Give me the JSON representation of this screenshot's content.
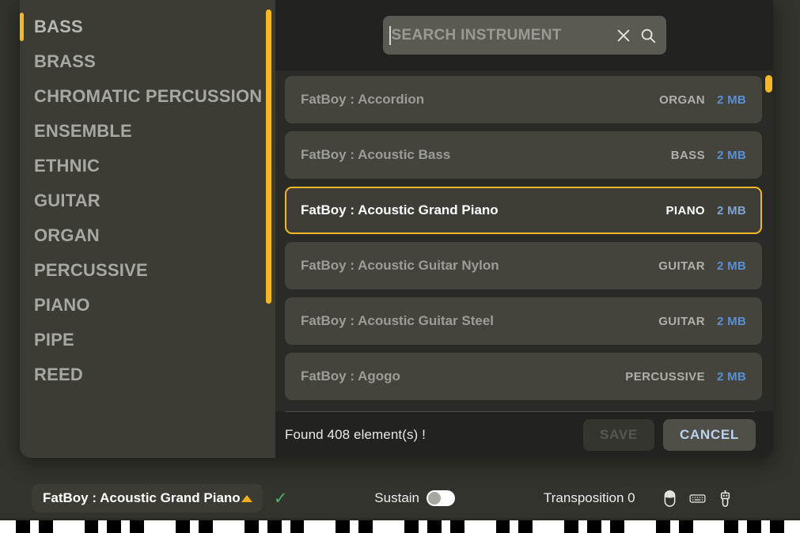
{
  "colors": {
    "accent_yellow": "#f5b824",
    "chip_caret_orange": "#f0ad1e",
    "size_blue": "#5b8fd4",
    "cancel_blue": "#bad2ef",
    "check_green": "#4caf6d",
    "app_background": "#33332d",
    "modal_background": "#222220",
    "sidebar_background": "#3c3c35",
    "row_background": "#44443c"
  },
  "sidebar": {
    "name": "instrument-category-list",
    "selected": "BASS",
    "items": [
      {
        "label": "BASS",
        "selected": true
      },
      {
        "label": "BRASS",
        "selected": false
      },
      {
        "label": "CHROMATIC PERCUSSION",
        "selected": false
      },
      {
        "label": "ENSEMBLE",
        "selected": false
      },
      {
        "label": "ETHNIC",
        "selected": false
      },
      {
        "label": "GUITAR",
        "selected": false
      },
      {
        "label": "ORGAN",
        "selected": false
      },
      {
        "label": "PERCUSSIVE",
        "selected": false
      },
      {
        "label": "PIANO",
        "selected": false
      },
      {
        "label": "PIPE",
        "selected": false
      },
      {
        "label": "REED",
        "selected": false
      }
    ]
  },
  "search": {
    "value": "",
    "placeholder": "SEARCH INSTRUMENT",
    "clear_icon": "close-x-icon",
    "search_icon": "magnifier-icon"
  },
  "instrument_list": {
    "rows": [
      {
        "name": "FatBoy : Accordion",
        "category": "ORGAN",
        "size": "2 MB",
        "selected": false
      },
      {
        "name": "FatBoy : Acoustic Bass",
        "category": "BASS",
        "size": "2 MB",
        "selected": false
      },
      {
        "name": "FatBoy : Acoustic Grand Piano",
        "category": "PIANO",
        "size": "2 MB",
        "selected": true
      },
      {
        "name": "FatBoy : Acoustic Guitar Nylon",
        "category": "GUITAR",
        "size": "2 MB",
        "selected": false
      },
      {
        "name": "FatBoy : Acoustic Guitar Steel",
        "category": "GUITAR",
        "size": "2 MB",
        "selected": false
      },
      {
        "name": "FatBoy : Agogo",
        "category": "PERCUSSIVE",
        "size": "2 MB",
        "selected": false
      }
    ]
  },
  "footer": {
    "found_text": "Found 408 element(s) !",
    "save_label": "SAVE",
    "save_enabled": false,
    "cancel_label": "CANCEL",
    "cancel_enabled": true
  },
  "toolbar": {
    "current_instrument": "FatBoy : Acoustic Grand Piano",
    "loaded_check": "✓",
    "sustain_label": "Sustain",
    "sustain_on": false,
    "transposition_label": "Transposition 0",
    "io_icons": [
      "mouse-icon",
      "keyboard-icon",
      "usb-midi-icon"
    ]
  }
}
